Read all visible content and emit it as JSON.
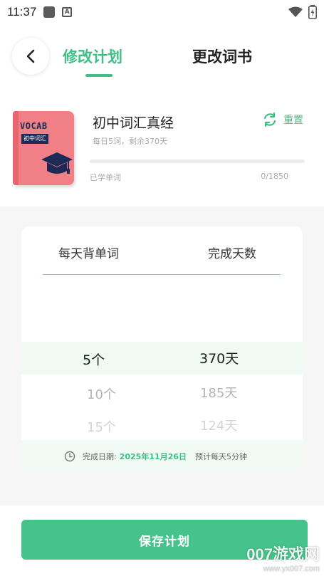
{
  "status_bar": {
    "time": "11:37",
    "icons": [
      "notification-icon",
      "a-icon",
      "wifi-icon",
      "battery-icon"
    ]
  },
  "header": {
    "back_icon": "chevron-left-icon",
    "tabs": [
      {
        "label": "修改计划",
        "active": true
      },
      {
        "label": "更改词书",
        "active": false
      }
    ]
  },
  "book": {
    "cover_text": "VOCAB",
    "cover_tag": "初中词汇",
    "title": "初中词汇真经",
    "subtitle": "每日5词，剩余370天",
    "reset_label": "重置",
    "progress_label": "已学单词",
    "progress_count": "0/1850",
    "progress_fraction": 0
  },
  "picker": {
    "columns": [
      "每天背单词",
      "完成天数"
    ],
    "rows": [
      {
        "words": "5个",
        "days": "370天"
      },
      {
        "words": "10个",
        "days": "185天"
      },
      {
        "words": "15个",
        "days": "124天"
      }
    ],
    "footer": {
      "date_label": "完成日期:",
      "date_value": "2025年11月26日",
      "estimate": "预计每天5分钟"
    }
  },
  "save_label": "保存计划",
  "watermark": {
    "main": "007游戏网",
    "url": "www.yx007.com"
  },
  "colors": {
    "accent": "#3fbf85",
    "button": "#44c48a",
    "cover": "#f17f86"
  }
}
